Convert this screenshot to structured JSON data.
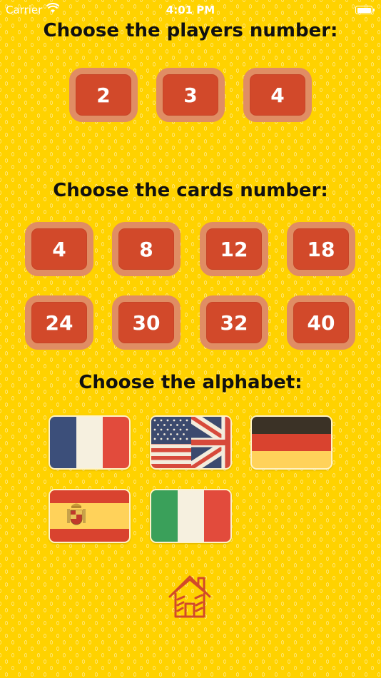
{
  "status_bar": {
    "carrier": "Carrier",
    "time": "4:01 PM"
  },
  "players": {
    "heading": "Choose the players number:",
    "options": [
      "2",
      "3",
      "4"
    ]
  },
  "cards": {
    "heading": "Choose the cards number:",
    "options": [
      "4",
      "8",
      "12",
      "18",
      "24",
      "30",
      "32",
      "40"
    ]
  },
  "alphabet": {
    "heading": "Choose the alphabet:",
    "flags": [
      "france-flag-icon",
      "usa-uk-flag-icon",
      "germany-flag-icon",
      "spain-flag-icon",
      "italy-flag-icon"
    ]
  },
  "home_icon": "home-icon",
  "colors": {
    "background": "#ffd200",
    "button_fill": "#d2492a",
    "button_border": "#e08d64",
    "text": "#111111"
  }
}
